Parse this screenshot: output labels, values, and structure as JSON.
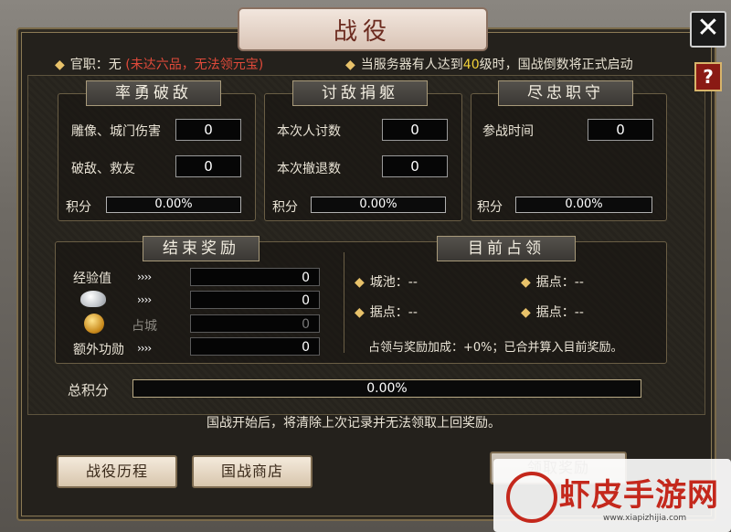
{
  "window": {
    "title": "战役",
    "close_icon": "close-icon",
    "help_label": "?"
  },
  "info": {
    "rank_label": "官职：无",
    "rank_note": "(未达六品，无法领元宝)",
    "server_msg_pre": "当服务器有人达到",
    "server_msg_level": "40",
    "server_msg_post": "级时，国战倒数将正式启动"
  },
  "sections": {
    "brave": {
      "title": "率勇破敌",
      "rows": [
        {
          "label": "雕像、城门伤害",
          "value": "0"
        },
        {
          "label": "破敌、救友",
          "value": "0"
        }
      ],
      "score_label": "积分",
      "score_value": "0.00%"
    },
    "punish": {
      "title": "讨敌捐躯",
      "rows": [
        {
          "label": "本次人讨数",
          "value": "0"
        },
        {
          "label": "本次撤退数",
          "value": "0"
        }
      ],
      "score_label": "积分",
      "score_value": "0.00%"
    },
    "loyal": {
      "title": "尽忠职守",
      "rows": [
        {
          "label": "参战时间",
          "value": "0"
        }
      ],
      "score_label": "积分",
      "score_value": "0.00%"
    }
  },
  "rewards": {
    "title": "结束奖励",
    "arrows": "››››",
    "rows": [
      {
        "label": "经验值",
        "value": "0"
      },
      {
        "label": "",
        "value": "0",
        "icon": "silver-ingot-icon"
      },
      {
        "label": "占城",
        "value": "0",
        "icon": "gold-coin-icon",
        "dim": true
      },
      {
        "label": "额外功勋",
        "value": "0"
      }
    ]
  },
  "occupation": {
    "title": "目前占领",
    "items": [
      {
        "label": "城池：--"
      },
      {
        "label": "据点：--"
      },
      {
        "label": "据点：--"
      },
      {
        "label": "据点：--"
      }
    ],
    "note": "占领与奖励加成：+0%；已合并算入目前奖励。"
  },
  "total": {
    "label": "总积分",
    "value": "0.00%"
  },
  "warning": "国战开始后，将清除上次记录并无法领取上回奖励。",
  "buttons": {
    "history": "战役历程",
    "shop": "国战商店",
    "claim": "领取奖励"
  },
  "watermark": {
    "text": "虾皮手游网",
    "url": "www.xiapizhijia.com"
  }
}
